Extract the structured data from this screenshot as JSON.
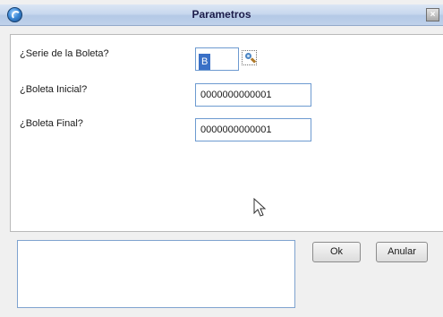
{
  "window": {
    "title": "Parametros",
    "close_glyph": "×",
    "app_icon": "app-orb-icon"
  },
  "form": {
    "serie_label": "¿Serie de la Boleta?",
    "serie_value": "B",
    "lookup_icon": "search-icon",
    "boleta_inicial_label": "¿Boleta Inicial?",
    "boleta_inicial_value": "0000000000001",
    "boleta_final_label": "¿Boleta Final?",
    "boleta_final_value": "0000000000001"
  },
  "memo": {
    "value": ""
  },
  "buttons": {
    "ok_label": "Ok",
    "cancel_label": "Anular"
  },
  "colors": {
    "field_border": "#6d9ad0",
    "selection": "#3a70c6",
    "title_text": "#1c1c4a"
  }
}
